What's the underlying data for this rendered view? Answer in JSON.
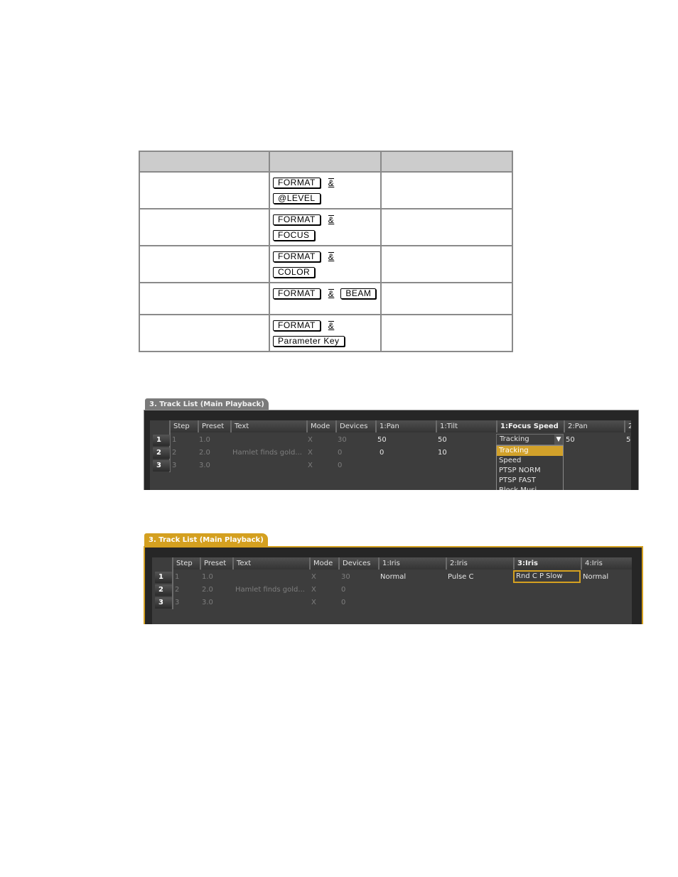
{
  "key_table": {
    "header": [
      "",
      "",
      ""
    ],
    "rows": [
      {
        "col1": "",
        "keys": [
          "FORMAT",
          "&",
          "@LEVEL"
        ],
        "layout": "two-line",
        "col3": ""
      },
      {
        "col1": "",
        "keys": [
          "FORMAT",
          "&",
          "FOCUS"
        ],
        "layout": "two-line",
        "col3": ""
      },
      {
        "col1": "",
        "keys": [
          "FORMAT",
          "&",
          "COLOR"
        ],
        "layout": "two-line",
        "col3": ""
      },
      {
        "col1": "",
        "keys": [
          "FORMAT",
          "&",
          "BEAM"
        ],
        "layout": "one-line",
        "col3": ""
      },
      {
        "col1": "",
        "keys": [
          "FORMAT",
          "&",
          "Parameter Key"
        ],
        "layout": "two-line",
        "col3": ""
      }
    ]
  },
  "panel1": {
    "tab_title": "3. Track List (Main Playback)",
    "columns": [
      "Step",
      "Preset",
      "Text",
      "Mode",
      "Devices",
      "1:Pan",
      "1:Tilt",
      "1:Focus Speed",
      "2:Pan",
      "2"
    ],
    "rows": [
      {
        "num": "1",
        "step": "1",
        "preset": "1.0",
        "text": "",
        "mode": "X",
        "devices": "30",
        "pan1": "50",
        "tilt1": "50",
        "focus_speed1": "Tracking",
        "pan2": "50",
        "extra": "5"
      },
      {
        "num": "2",
        "step": "2",
        "preset": "2.0",
        "text": "Hamlet finds gold...",
        "mode": "X",
        "devices": "0",
        "pan1": "0",
        "tilt1": "10",
        "focus_speed1": "",
        "pan2": "",
        "extra": ""
      },
      {
        "num": "3",
        "step": "3",
        "preset": "3.0",
        "text": "",
        "mode": "X",
        "devices": "0",
        "pan1": "",
        "tilt1": "",
        "focus_speed1": "",
        "pan2": "",
        "extra": ""
      }
    ],
    "dropdown": {
      "value": "Tracking",
      "arrow_icon": "triangle-down",
      "options": [
        "Tracking",
        "Speed",
        "PTSP NORM",
        "PTSP FAST",
        "Block Musi..."
      ],
      "highlighted": "Tracking"
    }
  },
  "panel2": {
    "tab_title": "3. Track List (Main Playback)",
    "columns": [
      "Step",
      "Preset",
      "Text",
      "Mode",
      "Devices",
      "1:Iris",
      "2:Iris",
      "3:Iris",
      "4:Iris"
    ],
    "rows": [
      {
        "num": "1",
        "step": "1",
        "preset": "1.0",
        "text": "",
        "mode": "X",
        "devices": "30",
        "iris1": "Normal",
        "iris2": "Pulse C",
        "iris3": "Rnd C P Slow",
        "iris4": "Normal"
      },
      {
        "num": "2",
        "step": "2",
        "preset": "2.0",
        "text": "Hamlet finds gold...",
        "mode": "X",
        "devices": "0",
        "iris1": "",
        "iris2": "",
        "iris3": "",
        "iris4": ""
      },
      {
        "num": "3",
        "step": "3",
        "preset": "3.0",
        "text": "",
        "mode": "X",
        "devices": "0",
        "iris1": "",
        "iris2": "",
        "iris3": "",
        "iris4": ""
      }
    ],
    "selected_cell": "3:Iris row 1"
  },
  "colors": {
    "accent_gold": "#d4a020",
    "panel_bg": "#3d3d3d",
    "inactive_tab": "#7a7a7a"
  }
}
